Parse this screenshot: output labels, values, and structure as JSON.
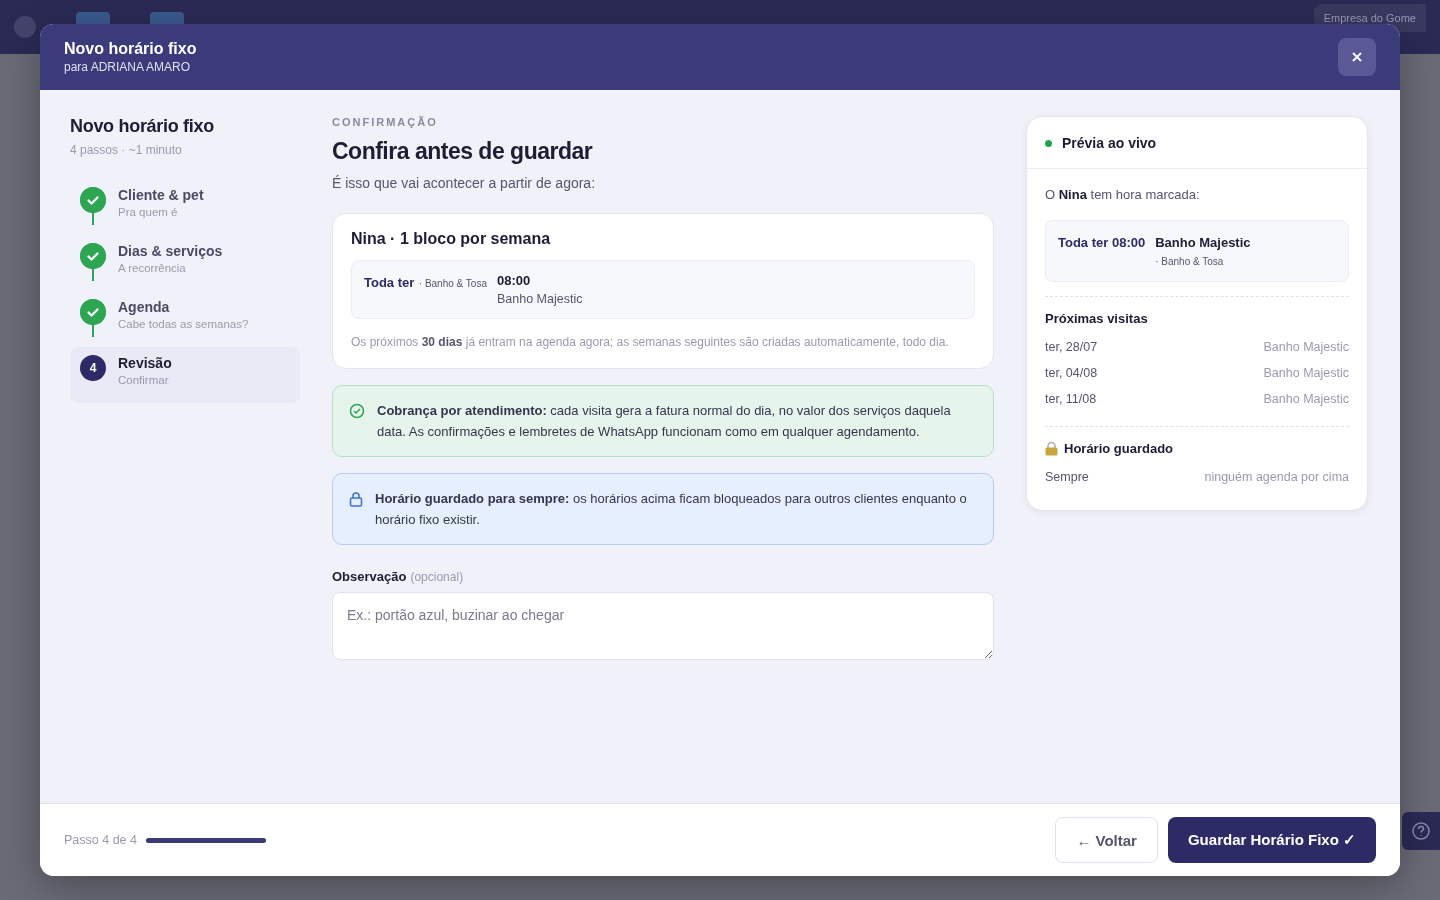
{
  "background": {
    "company": "Empresa do Gome"
  },
  "modal": {
    "title": "Novo horário fixo",
    "subtitle": "para ADRIANA AMARO"
  },
  "wizard": {
    "title": "Novo horário fixo",
    "meta": "4 passos · ~1 minuto",
    "steps": [
      {
        "label": "Cliente & pet",
        "hint": "Pra quem é",
        "done": true,
        "selected": false
      },
      {
        "label": "Dias & serviços",
        "hint": "A recorrência",
        "done": true,
        "selected": false
      },
      {
        "label": "Agenda",
        "hint": "Cabe todas as semanas?",
        "done": true,
        "selected": false
      },
      {
        "label": "Revisão",
        "hint": "Confirmar",
        "done": false,
        "selected": true,
        "number": "4"
      }
    ]
  },
  "review": {
    "eyebrow": "CONFIRMAÇÃO",
    "heading": "Confira antes de guardar",
    "intro": "É isso que vai acontecer a partir de agora:",
    "summary": {
      "title": "Nina · 1 bloco por semana",
      "day": "Toda ter",
      "category": "· Banho & Tosa",
      "time": "08:00",
      "service": "Banho Majestic",
      "note": "Os próximos **30 dias** já entram na agenda agora; as semanas seguintes são criadas automaticamente, todo dia."
    },
    "notices": [
      {
        "kind": "success",
        "text": "**Cobrança por atendimento:** cada visita gera a fatura normal do dia, no valor dos serviços daquela data. As confirmações e lembretes de WhatsApp funcionam como em qualquer agendamento."
      },
      {
        "kind": "info",
        "text": "**Horário guardado para sempre:** os horários acima ficam bloqueados para outros clientes enquanto o horário fixo existir."
      }
    ],
    "observation": {
      "label": "Observação",
      "hint": "(opcional)",
      "placeholder": "Ex.: portão azul, buzinar ao chegar"
    }
  },
  "preview": {
    "title": "Prévia ao vivo",
    "intro": "O **Nina** tem hora marcada:",
    "slot": {
      "when": "Toda ter 08:00",
      "service": "Banho Majestic",
      "category": "· Banho & Tosa"
    },
    "visits_title": "Próximas visitas",
    "visits": [
      {
        "date": "ter, 28/07",
        "service": "Banho Majestic"
      },
      {
        "date": "ter, 04/08",
        "service": "Banho Majestic"
      },
      {
        "date": "ter, 11/08",
        "service": "Banho Majestic"
      }
    ],
    "lock_title": "Horário guardado",
    "lock_label": "Sempre",
    "lock_value": "ninguém agenda por cima"
  },
  "footer": {
    "progress_text": "Passo 4 de 4",
    "level": 1,
    "back": "← Voltar",
    "save": "Guardar Horário Fixo ✓"
  }
}
